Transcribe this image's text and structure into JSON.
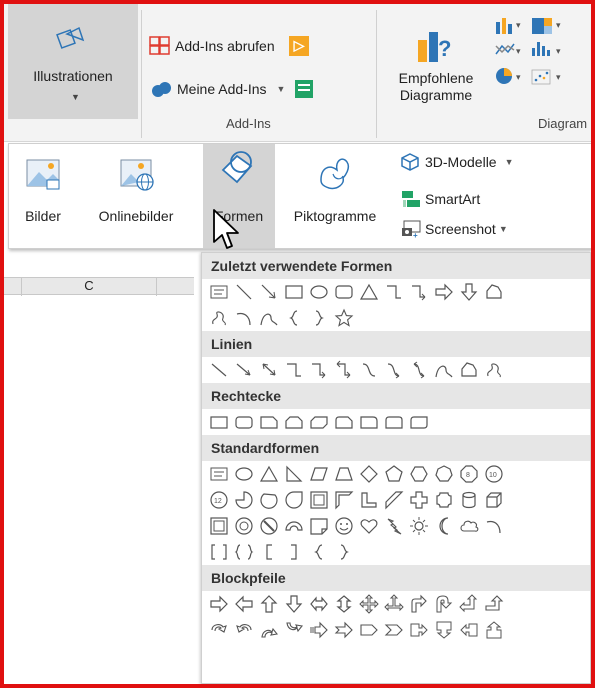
{
  "ribbon": {
    "illustrations_label": "Illustrationen",
    "get_addins_label": "Add-Ins abrufen",
    "my_addins_label": "Meine Add-Ins",
    "addins_group_label": "Add-Ins",
    "recommended_charts_label_1": "Empfohlene",
    "recommended_charts_label_2": "Diagramme",
    "charts_group_label": "Diagram"
  },
  "panel": {
    "pictures_label": "Bilder",
    "online_pictures_label": "Onlinebilder",
    "shapes_label": "Formen",
    "icons_label": "Piktogramme",
    "models3d_label": "3D-Modelle",
    "smartart_label": "SmartArt",
    "screenshot_label": "Screenshot"
  },
  "sheet": {
    "column_label": "C"
  },
  "gallery": {
    "recent_label": "Zuletzt verwendete Formen",
    "lines_label": "Linien",
    "rectangles_label": "Rechtecke",
    "basic_label": "Standardformen",
    "block_arrows_label": "Blockpfeile"
  },
  "colors": {
    "frame": "#e01010",
    "ribbon_bg": "#f3f3f3",
    "active_bg": "#d4d4d4",
    "icon_blue": "#2e75b6",
    "icon_orange": "#f5a623",
    "icon_red": "#e03c31",
    "icon_green": "#21a366"
  }
}
